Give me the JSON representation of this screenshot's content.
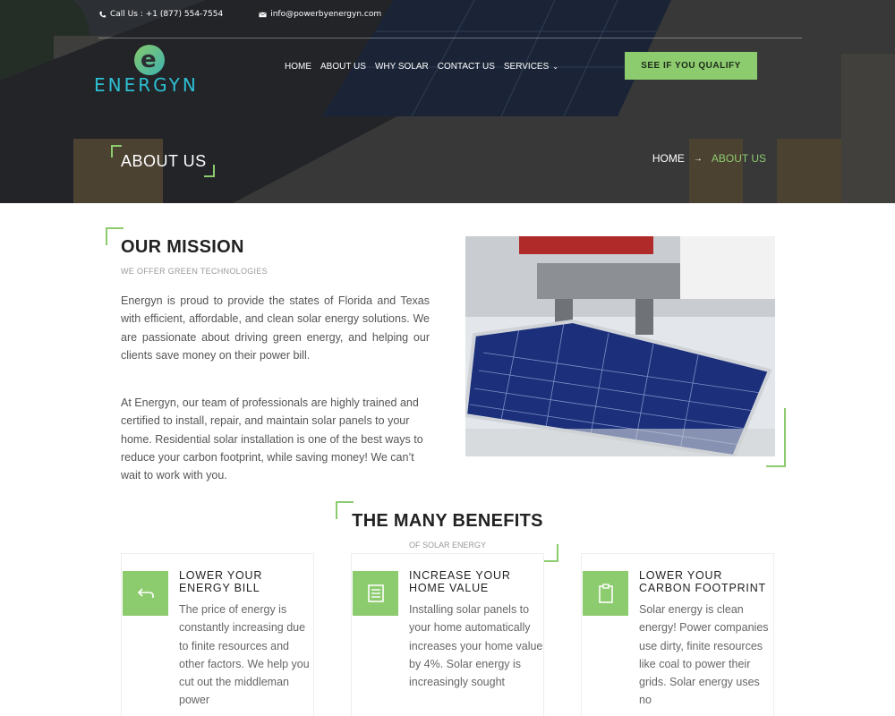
{
  "topbar": {
    "phone": "Call Us : +1 (877) 554-7554",
    "email": "info@powerbyenergyn.com"
  },
  "logo": {
    "mark": "e",
    "word": "ENERGYN"
  },
  "nav": {
    "items": [
      "HOME",
      "ABOUT US",
      "WHY SOLAR",
      "CONTACT US",
      "SERVICES"
    ],
    "cta": "SEE IF YOU QUALIFY"
  },
  "hero": {
    "title": "ABOUT US",
    "breadcrumb": {
      "home": "HOME",
      "separator": "→",
      "current": "ABOUT US"
    }
  },
  "mission": {
    "heading": "OUR MISSION",
    "subheading": "WE OFFER GREEN TECHNOLOGIES",
    "paragraphs": [
      "Energyn is proud to provide the states of Florida and Texas with efficient, affordable, and clean solar energy solutions. We are passionate about driving green energy, and helping our clients save money on their power bill.",
      "At Energyn, our team of professionals are highly trained and certified to install, repair, and maintain solar panels to your home. Residential solar installation is one of the best ways to reduce your carbon footprint, while saving money! We can’t wait to work with you."
    ]
  },
  "benefits": {
    "heading": "THE MANY BENEFITS",
    "subheading": "OF SOLAR ENERGY",
    "cards": [
      {
        "icon": "undo-arrow-icon",
        "title": "LOWER YOUR ENERGY BILL",
        "text": "The price of energy is constantly increasing due to finite resources and other factors. We help you cut out the middleman power"
      },
      {
        "icon": "document-icon",
        "title": "INCREASE YOUR HOME VALUE",
        "text": "Installing solar panels to your home automatically increases your home value by 4%. Solar energy is increasingly sought"
      },
      {
        "icon": "clipboard-icon",
        "title": "LOWER YOUR CARBON FOOTPRINT",
        "text": "Solar energy is clean energy! Power companies use dirty, finite resources like coal to power their grids. Solar energy uses no"
      }
    ]
  },
  "colors": {
    "accent": "#8ccb6e",
    "logo_text": "#2dbfd3",
    "hero_dark": "#2b2e33"
  }
}
